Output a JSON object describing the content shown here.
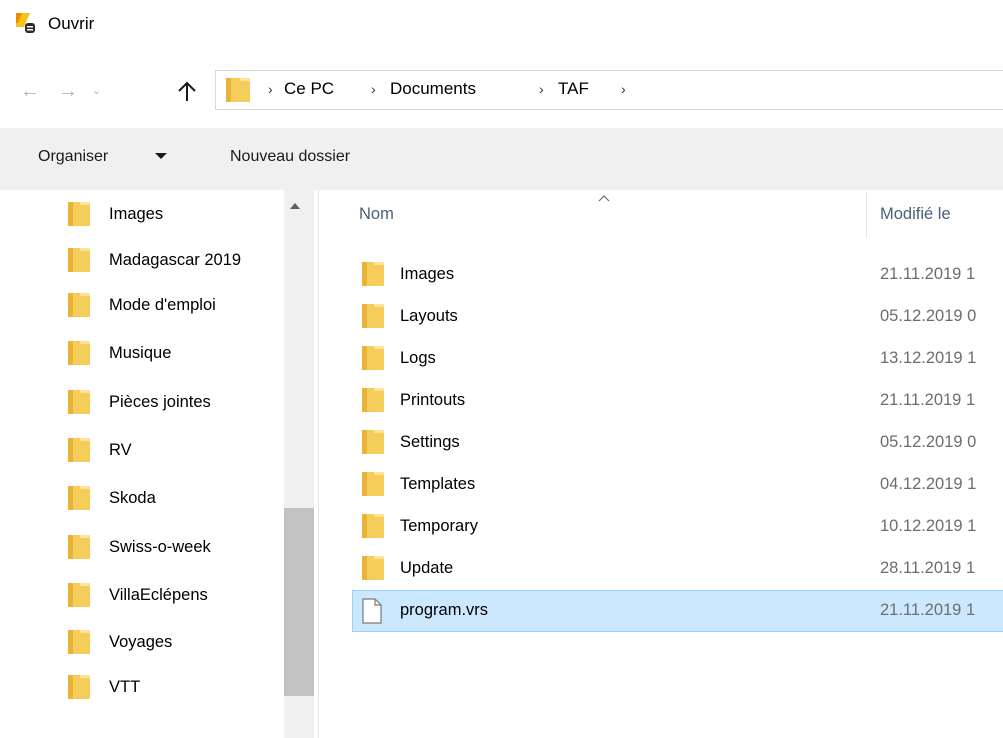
{
  "window": {
    "title": "Ouvrir"
  },
  "address": {
    "crumbs": [
      "Ce PC",
      "Documents",
      "TAF"
    ]
  },
  "toolbar": {
    "organise_label": "Organiser",
    "new_folder_label": "Nouveau dossier"
  },
  "nav_pane": {
    "items": [
      "Images",
      "Madagascar 2019",
      "Mode d'emploi",
      "Musique",
      "Pièces jointes",
      "RV",
      "Skoda",
      "Swiss-o-week",
      "VillaEclépens",
      "Voyages",
      "VTT"
    ]
  },
  "file_list": {
    "columns": {
      "name": "Nom",
      "modified": "Modifié le"
    },
    "rows": [
      {
        "name": "Images",
        "modified": "21.11.2019 1",
        "type": "folder"
      },
      {
        "name": "Layouts",
        "modified": "05.12.2019 0",
        "type": "folder"
      },
      {
        "name": "Logs",
        "modified": "13.12.2019 1",
        "type": "folder"
      },
      {
        "name": "Printouts",
        "modified": "21.11.2019 1",
        "type": "folder"
      },
      {
        "name": "Settings",
        "modified": "05.12.2019 0",
        "type": "folder"
      },
      {
        "name": "Templates",
        "modified": "04.12.2019 1",
        "type": "folder"
      },
      {
        "name": "Temporary",
        "modified": "10.12.2019 1",
        "type": "folder"
      },
      {
        "name": "Update",
        "modified": "28.11.2019 1",
        "type": "folder"
      },
      {
        "name": "program.vrs",
        "modified": "21.11.2019 1",
        "type": "file",
        "selected": true
      }
    ]
  },
  "colors": {
    "selection": "#cce8ff",
    "selection_border": "#99d1ff",
    "folder": "#f4cd5b",
    "header_text": "#4c607a"
  },
  "icons": [
    "app-icon",
    "back-arrow-icon",
    "forward-arrow-icon",
    "recent-locations-icon",
    "up-arrow-icon",
    "folder-icon",
    "file-icon",
    "chevron-right-icon",
    "sort-ascending-icon"
  ]
}
